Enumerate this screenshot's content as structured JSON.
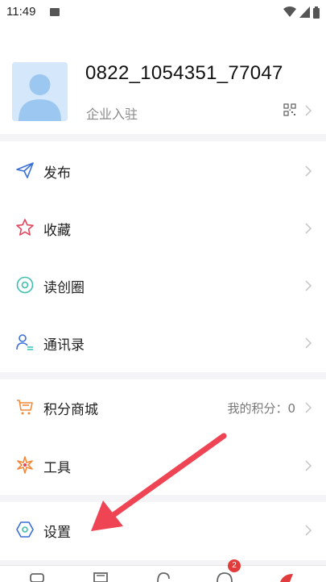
{
  "status_bar": {
    "time": "11:49",
    "icons": [
      "image-icon",
      "wifi-icon",
      "signal-icon",
      "battery-icon"
    ]
  },
  "profile": {
    "username": "0822_1054351_77047",
    "company_label": "企业入驻",
    "icons": [
      "avatar",
      "qr-code-icon",
      "chevron-right-icon"
    ]
  },
  "menu_group_1": [
    {
      "label": "发布",
      "icon": "paper-plane-icon",
      "color": "#3a6fd8"
    },
    {
      "label": "收藏",
      "icon": "star-icon",
      "color": "#e0455c"
    },
    {
      "label": "读创圈",
      "icon": "circle-target-icon",
      "color": "#3fbfb0"
    },
    {
      "label": "通讯录",
      "icon": "contacts-icon",
      "color": "#3a6fd8"
    }
  ],
  "menu_group_2": [
    {
      "label": "积分商城",
      "icon": "cart-icon",
      "color": "#f08a3a",
      "extra": "我的积分：0"
    },
    {
      "label": "工具",
      "icon": "tools-icon",
      "color": "#f08a3a"
    }
  ],
  "menu_group_3": [
    {
      "label": "设置",
      "icon": "hexagon-settings-icon",
      "color": "#3a6fd8"
    }
  ],
  "annotation": {
    "arrow_color": "#ef4454"
  },
  "tab_bar": {
    "badge_count": "2",
    "icons": [
      "home-icon",
      "news-icon",
      "refresh-icon",
      "message-icon",
      "profile-icon"
    ]
  }
}
